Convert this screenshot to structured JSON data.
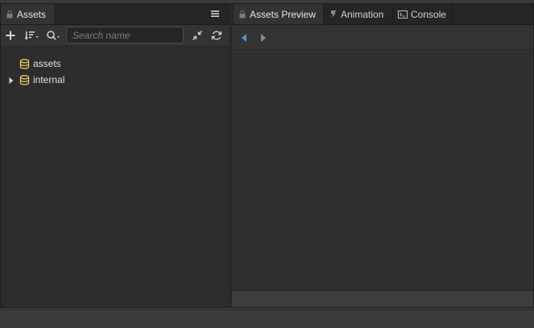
{
  "left_panel": {
    "tab": {
      "label": "Assets",
      "icon": "lock-icon"
    },
    "menu_icon": "hamburger-menu-icon",
    "toolbar": {
      "add_icon": "plus-icon",
      "sort_icon": "sort-icon",
      "search_filter_icon": "search-filter-icon",
      "collapse_icon": "collapse-icon",
      "refresh_icon": "refresh-icon"
    },
    "search": {
      "value": "",
      "placeholder": "Search name"
    },
    "tree": [
      {
        "label": "assets",
        "icon": "database-icon",
        "expandable": false
      },
      {
        "label": "internal",
        "icon": "database-icon",
        "expandable": true
      }
    ]
  },
  "right_panel": {
    "tabs": [
      {
        "label": "Assets Preview",
        "icon": "lock-icon",
        "active": true
      },
      {
        "label": "Animation",
        "icon": "animation-icon",
        "active": false
      },
      {
        "label": "Console",
        "icon": "console-icon",
        "active": false
      }
    ],
    "nav": {
      "back_icon": "back-arrow-icon",
      "forward_icon": "forward-arrow-icon"
    }
  },
  "colors": {
    "accent": "#4d8fd1",
    "db_icon": "#e8c45a",
    "panel_bg": "#2d2d2d"
  }
}
